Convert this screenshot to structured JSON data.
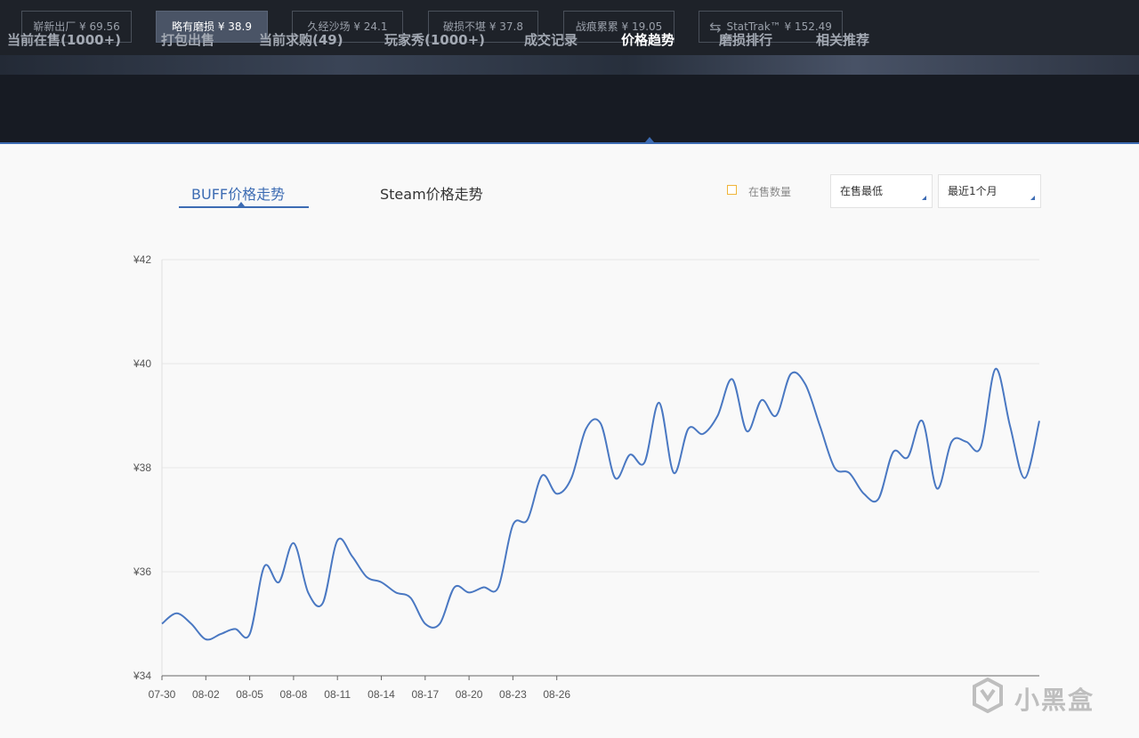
{
  "wear_buttons": [
    {
      "label": "崭新出厂 ¥ 69.56",
      "active": false
    },
    {
      "label": "略有磨损 ¥ 38.9",
      "active": true
    },
    {
      "label": "久经沙场 ¥ 24.1",
      "active": false
    },
    {
      "label": "破损不堪 ¥ 37.8",
      "active": false
    },
    {
      "label": "战痕累累 ¥ 19.05",
      "active": false
    },
    {
      "label": "StatTrak™ ¥ 152.49",
      "active": false,
      "icon": "swap-arrows-icon"
    }
  ],
  "tabs": [
    {
      "label": "当前在售(1000+)"
    },
    {
      "label": "打包出售"
    },
    {
      "label": "当前求购(49)"
    },
    {
      "label": "玩家秀(1000+)"
    },
    {
      "label": "成交记录"
    },
    {
      "label": "价格趋势",
      "active": true
    },
    {
      "label": "磨损排行"
    },
    {
      "label": "相关推荐"
    }
  ],
  "sub_tabs": {
    "buff": "BUFF价格走势",
    "steam": "Steam价格走势"
  },
  "legend": {
    "label": "在售数量",
    "color": "#f0b53a"
  },
  "selects": {
    "price_type": "在售最低",
    "range": "最近1个月"
  },
  "watermark": {
    "text": "小黑盒"
  },
  "colors": {
    "line": "#4a78c2",
    "accent": "#3d6cb3",
    "grid": "#e6e6e6"
  },
  "chart_data": {
    "type": "line",
    "title": "",
    "xlabel": "",
    "ylabel": "",
    "ylim": [
      34,
      42
    ],
    "y_ticks": [
      34,
      36,
      38,
      40,
      42
    ],
    "y_tick_labels": [
      "¥34",
      "¥36",
      "¥38",
      "¥40",
      "¥42"
    ],
    "x_tick_labels": [
      "07-30",
      "08-02",
      "08-05",
      "08-08",
      "08-11",
      "08-14",
      "08-17",
      "08-20",
      "08-23",
      "08-26"
    ],
    "grid": true,
    "series": [
      {
        "values": [
          35.0,
          35.2,
          35.0,
          34.7,
          34.8,
          34.9,
          34.8,
          36.1,
          35.8,
          36.55,
          35.6,
          35.4,
          36.6,
          36.3,
          35.9,
          35.8,
          35.6,
          35.5,
          35.0,
          35.0,
          35.7,
          35.6,
          35.7,
          35.7,
          36.9,
          37.0,
          37.85,
          37.5,
          37.8,
          38.75,
          38.85,
          37.8,
          38.25,
          38.1,
          39.25,
          37.9,
          38.75,
          38.65,
          39.0,
          39.7,
          38.7,
          39.3,
          39.0,
          39.8,
          39.6,
          38.8,
          38.0,
          37.9,
          37.5,
          37.4,
          38.3,
          38.2,
          38.9,
          37.6,
          38.5,
          38.5,
          38.4,
          39.9,
          38.8,
          37.8,
          38.9
        ]
      }
    ]
  }
}
